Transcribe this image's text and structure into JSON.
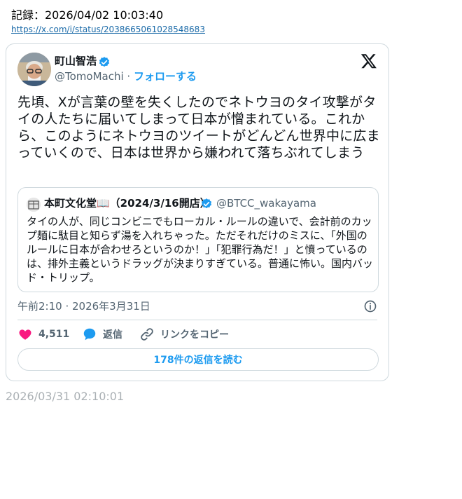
{
  "record": {
    "label": "記録：2026/04/02 10:03:40",
    "url": "https://x.com/i/status/2038665061028548683"
  },
  "tweet": {
    "author_name": "町山智浩",
    "handle": "@TomoMachi",
    "separator": "·",
    "follow_label": "フォローする",
    "text": "先頃、Xが言葉の壁を失くしたのでネトウヨのタイ攻撃がタイの人たちに届いてしまって日本が憎まれている。これから、このようにネトウヨのツイートがどんどん世界中に広まっていくので、日本は世界から嫌われて落ちぶれてしまう",
    "timestamp": "午前2:10 · 2026年3月31日",
    "likes": "4,511",
    "reply_label": "返信",
    "copy_link_label": "リンクをコピー",
    "read_replies_label": "178件の返信を読む"
  },
  "quote": {
    "author_name": "本町文化堂📖（2024/3/16開店）",
    "handle": "@BTCC_wakayama",
    "text": "タイの人が、同じコンビニでもローカル・ルールの違いで、会計前のカップ麺に駄目と知らず湯を入れちゃった。ただそれだけのミスに、「外国のルールに日本が合わせろというのか！」「犯罪行為だ！」と憤っているのは、排外主義というドラッグが決まりすぎている。普通に怖い。国内バッド・トリップ。"
  },
  "footer": {
    "archived_time": "2026/03/31 02:10:01"
  },
  "colors": {
    "accent": "#1d9bf0",
    "like": "#f91880",
    "muted": "#536471",
    "border": "#cfd9de"
  },
  "icons": {
    "verified": "verified-badge-icon",
    "x_logo": "x-logo-icon",
    "info": "info-icon",
    "like": "heart-icon",
    "reply": "speech-bubble-icon",
    "copy_link": "link-icon"
  }
}
